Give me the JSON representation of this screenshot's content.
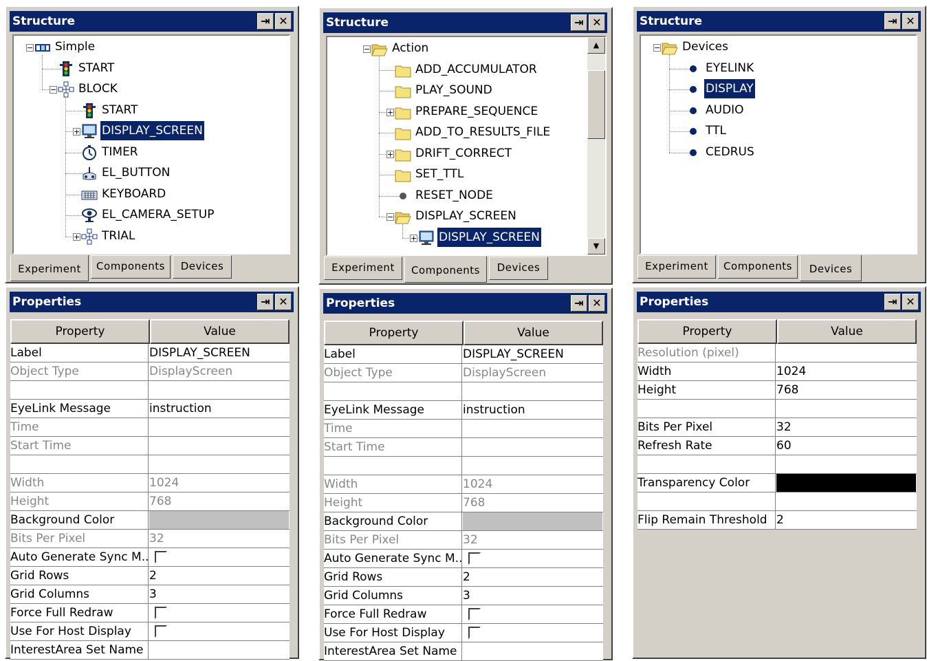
{
  "titles": {
    "structure": "Structure",
    "properties": "Properties"
  },
  "tabs": [
    "Experiment",
    "Components",
    "Devices"
  ],
  "headers": {
    "property": "Property",
    "value": "Value"
  },
  "tree1": [
    {
      "label": "Simple",
      "icon": "experiment-icon",
      "level": 0,
      "expand": "minus"
    },
    {
      "label": "START",
      "icon": "traffic-light-icon",
      "level": 1
    },
    {
      "label": "BLOCK",
      "icon": "sequence-icon",
      "level": 1,
      "expand": "minus"
    },
    {
      "label": "START",
      "icon": "traffic-light-icon",
      "level": 2
    },
    {
      "label": "DISPLAY_SCREEN",
      "icon": "monitor-icon",
      "level": 2,
      "expand": "plus",
      "selected": true
    },
    {
      "label": "TIMER",
      "icon": "timer-icon",
      "level": 2
    },
    {
      "label": "EL_BUTTON",
      "icon": "gamepad-icon",
      "level": 2
    },
    {
      "label": "KEYBOARD",
      "icon": "keyboard-icon",
      "level": 2
    },
    {
      "label": "EL_CAMERA_SETUP",
      "icon": "eye-icon",
      "level": 2
    },
    {
      "label": "TRIAL",
      "icon": "sequence-icon",
      "level": 2,
      "expand": "plus"
    }
  ],
  "tree2": [
    {
      "label": "Action",
      "icon": "folder-open-icon",
      "level": 0,
      "expand": "minus"
    },
    {
      "label": "ADD_ACCUMULATOR",
      "icon": "folder-icon",
      "level": 1
    },
    {
      "label": "PLAY_SOUND",
      "icon": "folder-icon",
      "level": 1
    },
    {
      "label": "PREPARE_SEQUENCE",
      "icon": "folder-icon",
      "level": 1,
      "expand": "plus"
    },
    {
      "label": "ADD_TO_RESULTS_FILE",
      "icon": "folder-icon",
      "level": 1
    },
    {
      "label": "DRIFT_CORRECT",
      "icon": "folder-icon",
      "level": 1,
      "expand": "plus"
    },
    {
      "label": "SET_TTL",
      "icon": "folder-icon",
      "level": 1
    },
    {
      "label": "RESET_NODE",
      "icon": "gray-dot-icon",
      "level": 1
    },
    {
      "label": "DISPLAY_SCREEN",
      "icon": "folder-open-icon",
      "level": 1,
      "expand": "minus"
    },
    {
      "label": "DISPLAY_SCREEN",
      "icon": "monitor-icon",
      "level": 2,
      "expand": "plus",
      "selected": true
    }
  ],
  "tree3": [
    {
      "label": "Devices",
      "icon": "folder-open-icon",
      "level": 0,
      "expand": "minus"
    },
    {
      "label": "EYELINK",
      "icon": "dot-icon",
      "level": 1
    },
    {
      "label": "DISPLAY",
      "icon": "dot-icon",
      "level": 1,
      "selected": true
    },
    {
      "label": "AUDIO",
      "icon": "dot-icon",
      "level": 1
    },
    {
      "label": "TTL",
      "icon": "dot-icon",
      "level": 1
    },
    {
      "label": "CEDRUS",
      "icon": "dot-icon",
      "level": 1
    }
  ],
  "props1": [
    {
      "k": "Label",
      "v": "DISPLAY_SCREEN"
    },
    {
      "k": "Object Type",
      "v": "DisplayScreen",
      "gray": true
    },
    {
      "k": "",
      "v": ""
    },
    {
      "k": "EyeLink Message",
      "v": "instruction"
    },
    {
      "k": "Time",
      "v": "",
      "gray": true
    },
    {
      "k": "Start Time",
      "v": "",
      "gray": true
    },
    {
      "k": "",
      "v": ""
    },
    {
      "k": "Width",
      "v": "1024",
      "gray": true
    },
    {
      "k": "Height",
      "v": "768",
      "gray": true
    },
    {
      "k": "Background Color",
      "v": "",
      "color": "#c0c0c0"
    },
    {
      "k": "Bits Per Pixel",
      "v": "32",
      "gray": true
    },
    {
      "k": "Auto Generate Sync M...",
      "v": "",
      "check": true
    },
    {
      "k": "Grid Rows",
      "v": "2"
    },
    {
      "k": "Grid Columns",
      "v": "3"
    },
    {
      "k": "Force Full Redraw",
      "v": "",
      "check": true
    },
    {
      "k": "Use For Host Display",
      "v": "",
      "check": true
    },
    {
      "k": "InterestArea Set Name",
      "v": ""
    }
  ],
  "props3": [
    {
      "k": "Resolution (pixel)",
      "v": "",
      "gray": true
    },
    {
      "k": "Width",
      "v": "1024"
    },
    {
      "k": "Height",
      "v": "768"
    },
    {
      "k": "",
      "v": ""
    },
    {
      "k": "Bits Per Pixel",
      "v": "32"
    },
    {
      "k": "Refresh Rate",
      "v": "60"
    },
    {
      "k": "",
      "v": ""
    },
    {
      "k": "Transparency Color",
      "v": "",
      "color": "#000000"
    },
    {
      "k": "",
      "v": ""
    },
    {
      "k": "Flip Remain Threshold",
      "v": "2"
    }
  ]
}
